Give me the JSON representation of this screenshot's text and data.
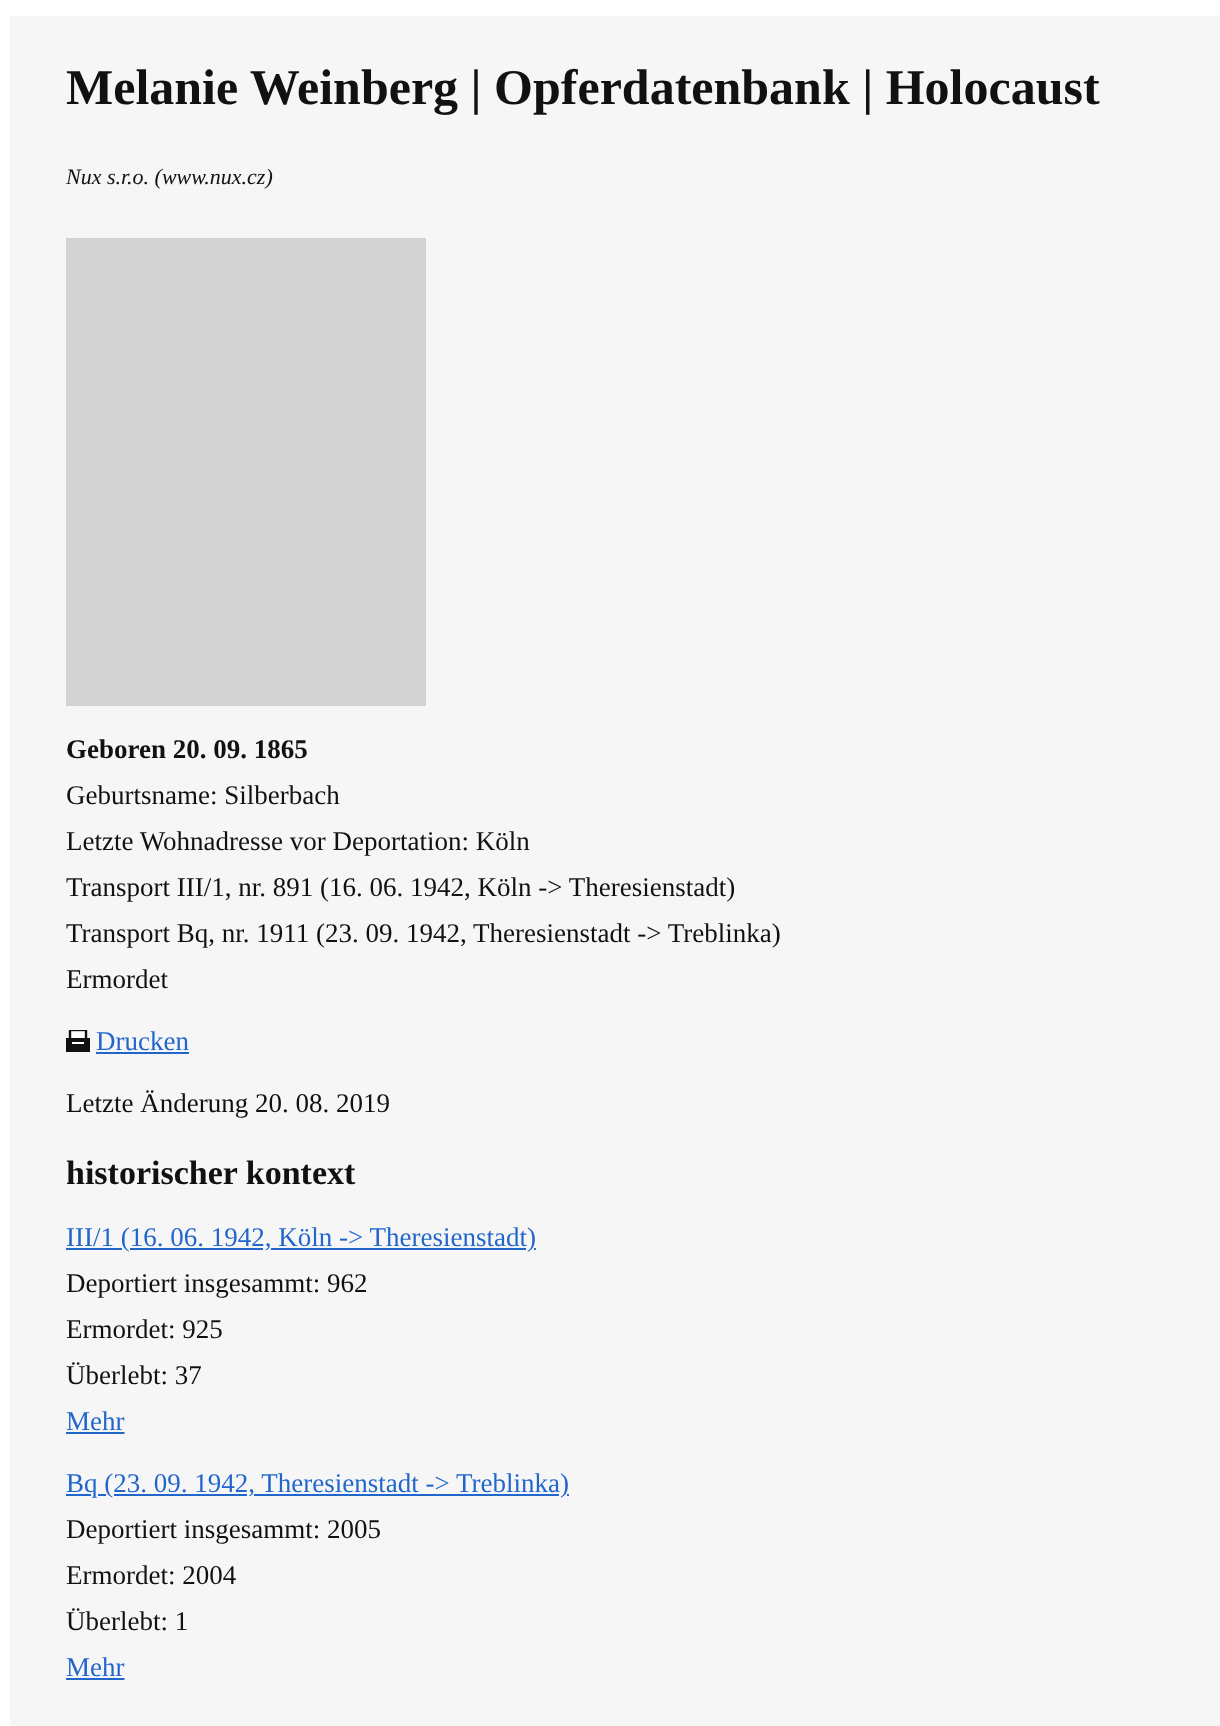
{
  "title": "Melanie Weinberg | Opferdatenbank | Holocaust",
  "publisher": "Nux s.r.o. (www.nux.cz)",
  "photo": {
    "kind": "placeholder"
  },
  "born": "Geboren 20. 09. 1865",
  "details": [
    "Geburtsname: Silberbach",
    "Letzte Wohnadresse vor Deportation: Köln",
    "Transport III/1, nr. 891 (16. 06. 1942, Köln -> Theresienstadt)",
    "Transport Bq, nr. 1911 (23. 09. 1942, Theresienstadt -> Treblinka)",
    "Ermordet"
  ],
  "print_link": "Drucken",
  "last_change": "Letzte Änderung 20. 08. 2019",
  "context_heading": "historischer kontext",
  "transports": [
    {
      "link": "III/1 (16. 06. 1942, Köln -> Theresienstadt)",
      "stats": [
        "Deportiert insgesammt: 962",
        "Ermordet: 925",
        "Überlebt: 37"
      ],
      "more": "Mehr"
    },
    {
      "link": "Bq (23. 09. 1942, Theresienstadt -> Treblinka)",
      "stats": [
        "Deportiert insgesammt: 2005",
        "Ermordet: 2004",
        "Überlebt: 1"
      ],
      "more": "Mehr"
    }
  ]
}
